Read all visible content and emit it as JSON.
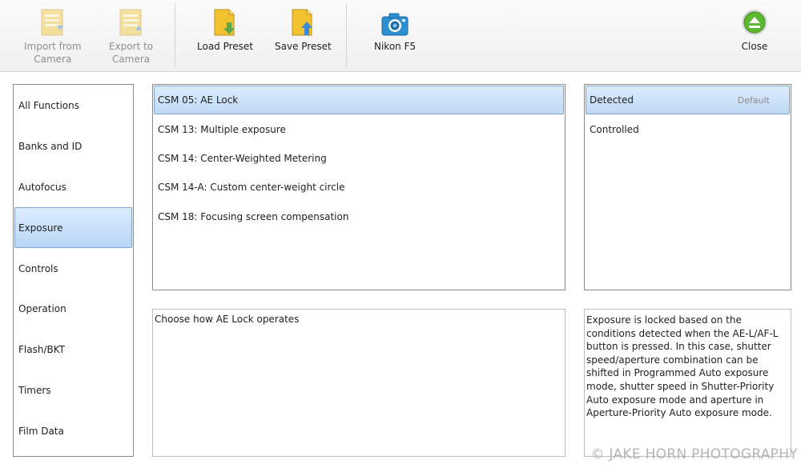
{
  "toolbar": {
    "import": {
      "line1": "Import from",
      "line2": "Camera"
    },
    "export": {
      "line1": "Export to",
      "line2": "Camera"
    },
    "load_preset": "Load Preset",
    "save_preset": "Save Preset",
    "camera": "Nikon F5",
    "close": "Close"
  },
  "nav": {
    "items": [
      {
        "label": "All Functions"
      },
      {
        "label": "Banks and ID"
      },
      {
        "label": "Autofocus"
      },
      {
        "label": "Exposure"
      },
      {
        "label": "Controls"
      },
      {
        "label": "Operation"
      },
      {
        "label": "Flash/BKT"
      },
      {
        "label": "Timers"
      },
      {
        "label": "Film Data"
      }
    ],
    "selected": "Exposure"
  },
  "settings": {
    "items": [
      {
        "label": "CSM 05: AE Lock"
      },
      {
        "label": "CSM 13: Multiple exposure"
      },
      {
        "label": "CSM 14: Center-Weighted Metering"
      },
      {
        "label": "CSM 14-A: Custom center-weight circle"
      },
      {
        "label": "CSM 18: Focusing screen compensation"
      }
    ],
    "selected": "CSM 05: AE Lock"
  },
  "options": {
    "items": [
      {
        "label": "Detected",
        "badge": "Default"
      },
      {
        "label": "Controlled"
      }
    ],
    "selected": "Detected"
  },
  "description": "Choose how AE Lock operates",
  "help": "Exposure is locked based on the conditions detected when the AE-L/AF-L button is pressed. In this case, shutter speed/aperture combination can be shifted in Programmed Auto exposure mode, shutter speed in Shutter-Priority Auto exposure mode and aperture in Aperture-Priority Auto exposure mode.",
  "watermark": "© JAKE HORN PHOTOGRAPHY",
  "colors": {
    "selection_top": "#dcecfd",
    "selection_bottom": "#b9d6f7",
    "selection_border": "#7da2ce",
    "folder": "#f2c230",
    "camera_icon": "#2e8fd0",
    "close_icon": "#5cb82e"
  },
  "icons": {
    "import": "folder-camera-import-icon",
    "export": "folder-camera-export-icon",
    "load": "folder-down-arrow-icon",
    "save": "folder-up-arrow-icon",
    "camera": "camera-icon",
    "close": "eject-circle-icon"
  }
}
